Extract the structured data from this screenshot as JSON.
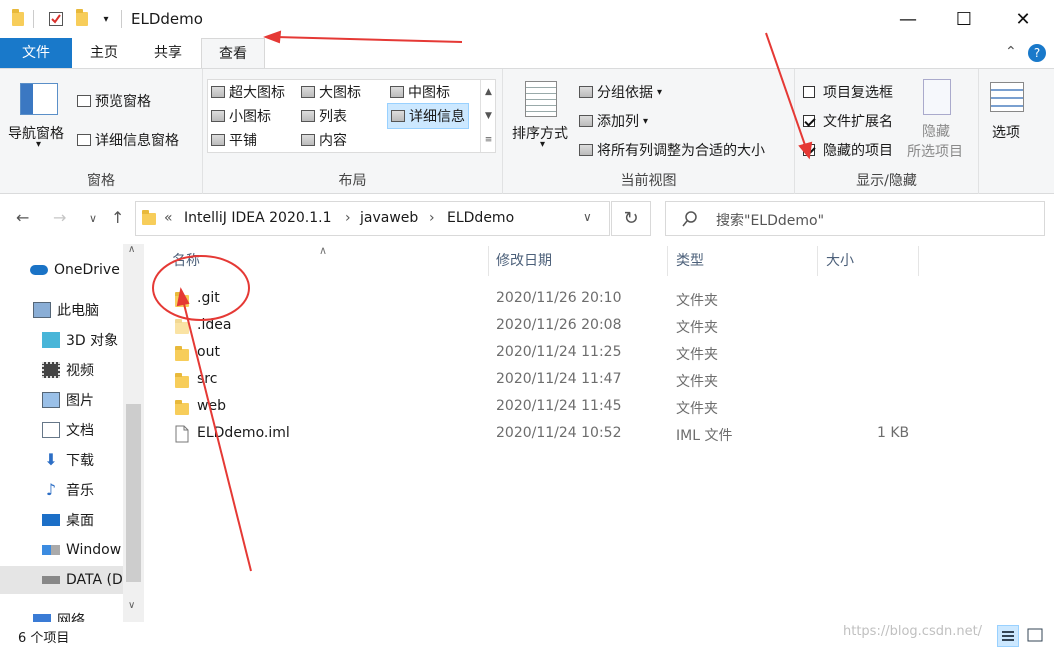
{
  "window": {
    "title": "ELDdemo",
    "minimize": "—",
    "maximize": "☐",
    "close": "✕"
  },
  "ribbon_tabs": [
    {
      "label": "文件"
    },
    {
      "label": "主页"
    },
    {
      "label": "共享"
    },
    {
      "label": "查看"
    }
  ],
  "ribbon": {
    "panes": {
      "nav_pane": "导航窗格",
      "preview_pane": "预览窗格",
      "details_pane": "详细信息窗格",
      "group_label": "窗格"
    },
    "layout": {
      "items": [
        "超大图标",
        "大图标",
        "中图标",
        "小图标",
        "列表",
        "详细信息",
        "平铺",
        "内容"
      ],
      "selected": "详细信息",
      "group_label": "布局"
    },
    "current_view": {
      "sort_by": "排序方式",
      "group_by": "分组依据",
      "add_column": "添加列",
      "fit_columns": "将所有列调整为合适的大小",
      "group_label": "当前视图"
    },
    "show_hide": {
      "item_checkboxes": {
        "label": "项目复选框",
        "checked": false
      },
      "file_extensions": {
        "label": "文件扩展名",
        "checked": true
      },
      "hidden_items": {
        "label": "隐藏的项目",
        "checked": true
      },
      "hide_selected_line1": "隐藏",
      "hide_selected_line2": "所选项目",
      "group_label": "显示/隐藏"
    },
    "options": "选项"
  },
  "address": {
    "chevron": "«",
    "segments": [
      "IntelliJ IDEA 2020.1.1",
      "javaweb",
      "ELDdemo"
    ],
    "separator": "›"
  },
  "search": {
    "placeholder": "搜索\"ELDdemo\""
  },
  "nav_pane": [
    {
      "label": "OneDrive",
      "icon": "cloud-icon"
    },
    {
      "label": "此电脑",
      "icon": "computer-icon"
    },
    {
      "label": "3D 对象",
      "icon": "cube-icon"
    },
    {
      "label": "视频",
      "icon": "video-icon"
    },
    {
      "label": "图片",
      "icon": "picture-icon"
    },
    {
      "label": "文档",
      "icon": "document-icon"
    },
    {
      "label": "下载",
      "icon": "download-icon"
    },
    {
      "label": "音乐",
      "icon": "music-icon"
    },
    {
      "label": "桌面",
      "icon": "desktop-icon"
    },
    {
      "label": "Window",
      "icon": "drive-icon"
    },
    {
      "label": "DATA (D",
      "icon": "drive-icon"
    },
    {
      "label": "网络",
      "icon": "network-icon"
    }
  ],
  "columns": {
    "name": "名称",
    "modified": "修改日期",
    "type": "类型",
    "size": "大小"
  },
  "files": [
    {
      "name": ".git",
      "modified": "2020/11/26 20:10",
      "type": "文件夹",
      "size": "",
      "kind": "folder"
    },
    {
      "name": ".idea",
      "modified": "2020/11/26 20:08",
      "type": "文件夹",
      "size": "",
      "kind": "folder"
    },
    {
      "name": "out",
      "modified": "2020/11/24 11:25",
      "type": "文件夹",
      "size": "",
      "kind": "folder"
    },
    {
      "name": "src",
      "modified": "2020/11/24 11:47",
      "type": "文件夹",
      "size": "",
      "kind": "folder"
    },
    {
      "name": "web",
      "modified": "2020/11/24 11:45",
      "type": "文件夹",
      "size": "",
      "kind": "folder"
    },
    {
      "name": "ELDdemo.iml",
      "modified": "2020/11/24 10:52",
      "type": "IML 文件",
      "size": "1 KB",
      "kind": "file"
    }
  ],
  "status": {
    "count": "6 个项目"
  },
  "watermark": "https://blog.csdn.net/",
  "colors": {
    "accent": "#1979ca",
    "annotation": "#e53935",
    "folder": "#f7cd5a"
  }
}
